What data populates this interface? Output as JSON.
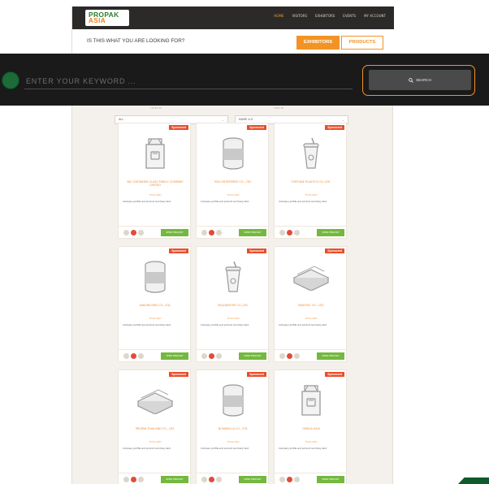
{
  "header": {
    "logo_line1": "PROPAK",
    "logo_line2": "ASIA",
    "nav": [
      "HOME",
      "VISITORS",
      "EXHIBITORS",
      "EVENTS",
      "MY ACCOUNT"
    ],
    "looking_for": "IS THIS WHAT YOU ARE LOOKING FOR?",
    "exhibitors_label": "EXHIBITORS",
    "products_label": "PRODUCTS"
  },
  "search": {
    "placeholder": "ENTER YOUR KEYWORD ...",
    "button_label": "SEARCH"
  },
  "filters": {
    "left_label": "FILTER BY",
    "left_value": "ALL",
    "right_label": "SORT BY",
    "right_value": "NAME A-Z"
  },
  "cards": [
    {
      "badge": "Sponsored",
      "icon": "carton-box-icon",
      "name": "BD CONTAINER GLASS PUBLIC COMPANY LIMITED",
      "location": "THAILAND",
      "desc": "Company profile and product summary text",
      "send": "SEND ENQUIRY"
    },
    {
      "badge": "Sponsored",
      "icon": "tin-can-icon",
      "name": "ENG ENTERPRISE CO., LTD.",
      "location": "THAILAND",
      "desc": "Company profile and product summary text",
      "send": "SEND ENQUIRY"
    },
    {
      "badge": "Sponsored",
      "icon": "cup-lid-straw-icon",
      "name": "FORTUNE PLASTICS CO.,LTD.",
      "location": "THAILAND",
      "desc": "Company profile and product summary text",
      "send": "SEND ENQUIRY"
    },
    {
      "badge": "Sponsored",
      "icon": "tin-can-icon",
      "name": "SAKURA INKS CO., LTD.",
      "location": "THAILAND",
      "desc": "Company profile and product summary text",
      "send": "SEND ENQUIRY"
    },
    {
      "badge": "Sponsored",
      "icon": "cup-lid-straw-icon",
      "name": "SEALMASTER CO.,LTD.",
      "location": "THAILAND",
      "desc": "Company profile and product summary text",
      "send": "SEND ENQUIRY"
    },
    {
      "badge": "Sponsored",
      "icon": "flat-box-icon",
      "name": "SIAM PAC CO., LTD.",
      "location": "THAILAND",
      "desc": "Company profile and product summary text",
      "send": "SEND ENQUIRY"
    },
    {
      "badge": "Sponsored",
      "icon": "flat-box-icon",
      "name": "PROPAK THAILAND CO., LTD.",
      "location": "THAILAND",
      "desc": "Company profile and product summary text",
      "send": "SEND ENQUIRY"
    },
    {
      "badge": "Sponsored",
      "icon": "tin-can-icon",
      "name": "NOVABELLA CO., LTD.",
      "location": "THAILAND",
      "desc": "Company profile and product summary text",
      "send": "SEND ENQUIRY"
    },
    {
      "badge": "Sponsored",
      "icon": "carton-box-icon",
      "name": "OMEGA ASIA",
      "location": "THAILAND",
      "desc": "Company profile and product summary text",
      "send": "SEND ENQUIRY"
    }
  ]
}
